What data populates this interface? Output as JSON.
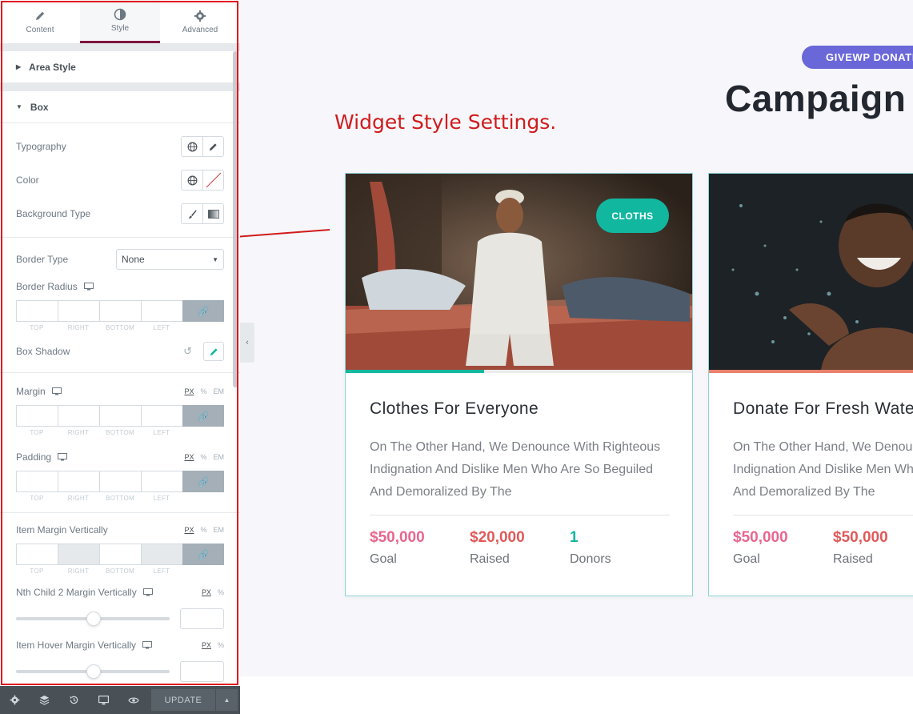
{
  "panel": {
    "tabs": [
      {
        "label": "Content",
        "icon": "pencil-icon"
      },
      {
        "label": "Style",
        "icon": "half-circle-icon",
        "active": true
      },
      {
        "label": "Advanced",
        "icon": "gear-icon"
      }
    ],
    "sections": {
      "area_style": "Area Style",
      "box": "Box"
    },
    "controls": {
      "typography": "Typography",
      "color": "Color",
      "background_type": "Background Type",
      "border_type": "Border Type",
      "border_type_value": "None",
      "border_radius": "Border Radius",
      "box_shadow": "Box Shadow",
      "margin": "Margin",
      "padding": "Padding",
      "item_margin_vertically": "Item Margin Vertically",
      "nth_child_2_margin": "Nth Child 2 Margin Vertically",
      "item_hover_margin": "Item Hover Margin Vertically"
    },
    "dim_labels": [
      "TOP",
      "RIGHT",
      "BOTTOM",
      "LEFT"
    ],
    "units": [
      "PX",
      "%",
      "EM"
    ],
    "units_short": [
      "PX",
      "%"
    ],
    "footer": {
      "update_label": "UPDATE"
    }
  },
  "preview": {
    "pill": "GIVEWP DONATION",
    "heading": "Campaign",
    "annotation": "Widget Style Settings.",
    "cards": [
      {
        "tag": "CLOTHS",
        "title": "Clothes For Everyone",
        "desc": [
          "On The Other Hand, We Denounce With Righteous",
          "Indignation And Dislike Men Who Are So Beguiled",
          "And Demoralized By The"
        ],
        "progress": 0.4,
        "bar_color": "#12b7a0",
        "stats": [
          {
            "value": "$50,000",
            "label": "Goal",
            "color": "#e8668f"
          },
          {
            "value": "$20,000",
            "label": "Raised",
            "color": "#e05a5a"
          },
          {
            "value": "1",
            "label": "Donors",
            "color": "#12b7a0"
          }
        ]
      },
      {
        "tag": "",
        "title": "Donate For Fresh Water",
        "desc": [
          "On The Other Hand, We Denounce With Righteous",
          "Indignation And Dislike Men Who Are So Beguiled",
          "And Demoralized By The"
        ],
        "progress": 1.0,
        "bar_color": "#e8806c",
        "stats": [
          {
            "value": "$50,000",
            "label": "Goal",
            "color": "#e8668f"
          },
          {
            "value": "$50,000",
            "label": "Raised",
            "color": "#e05a5a"
          }
        ]
      }
    ]
  }
}
